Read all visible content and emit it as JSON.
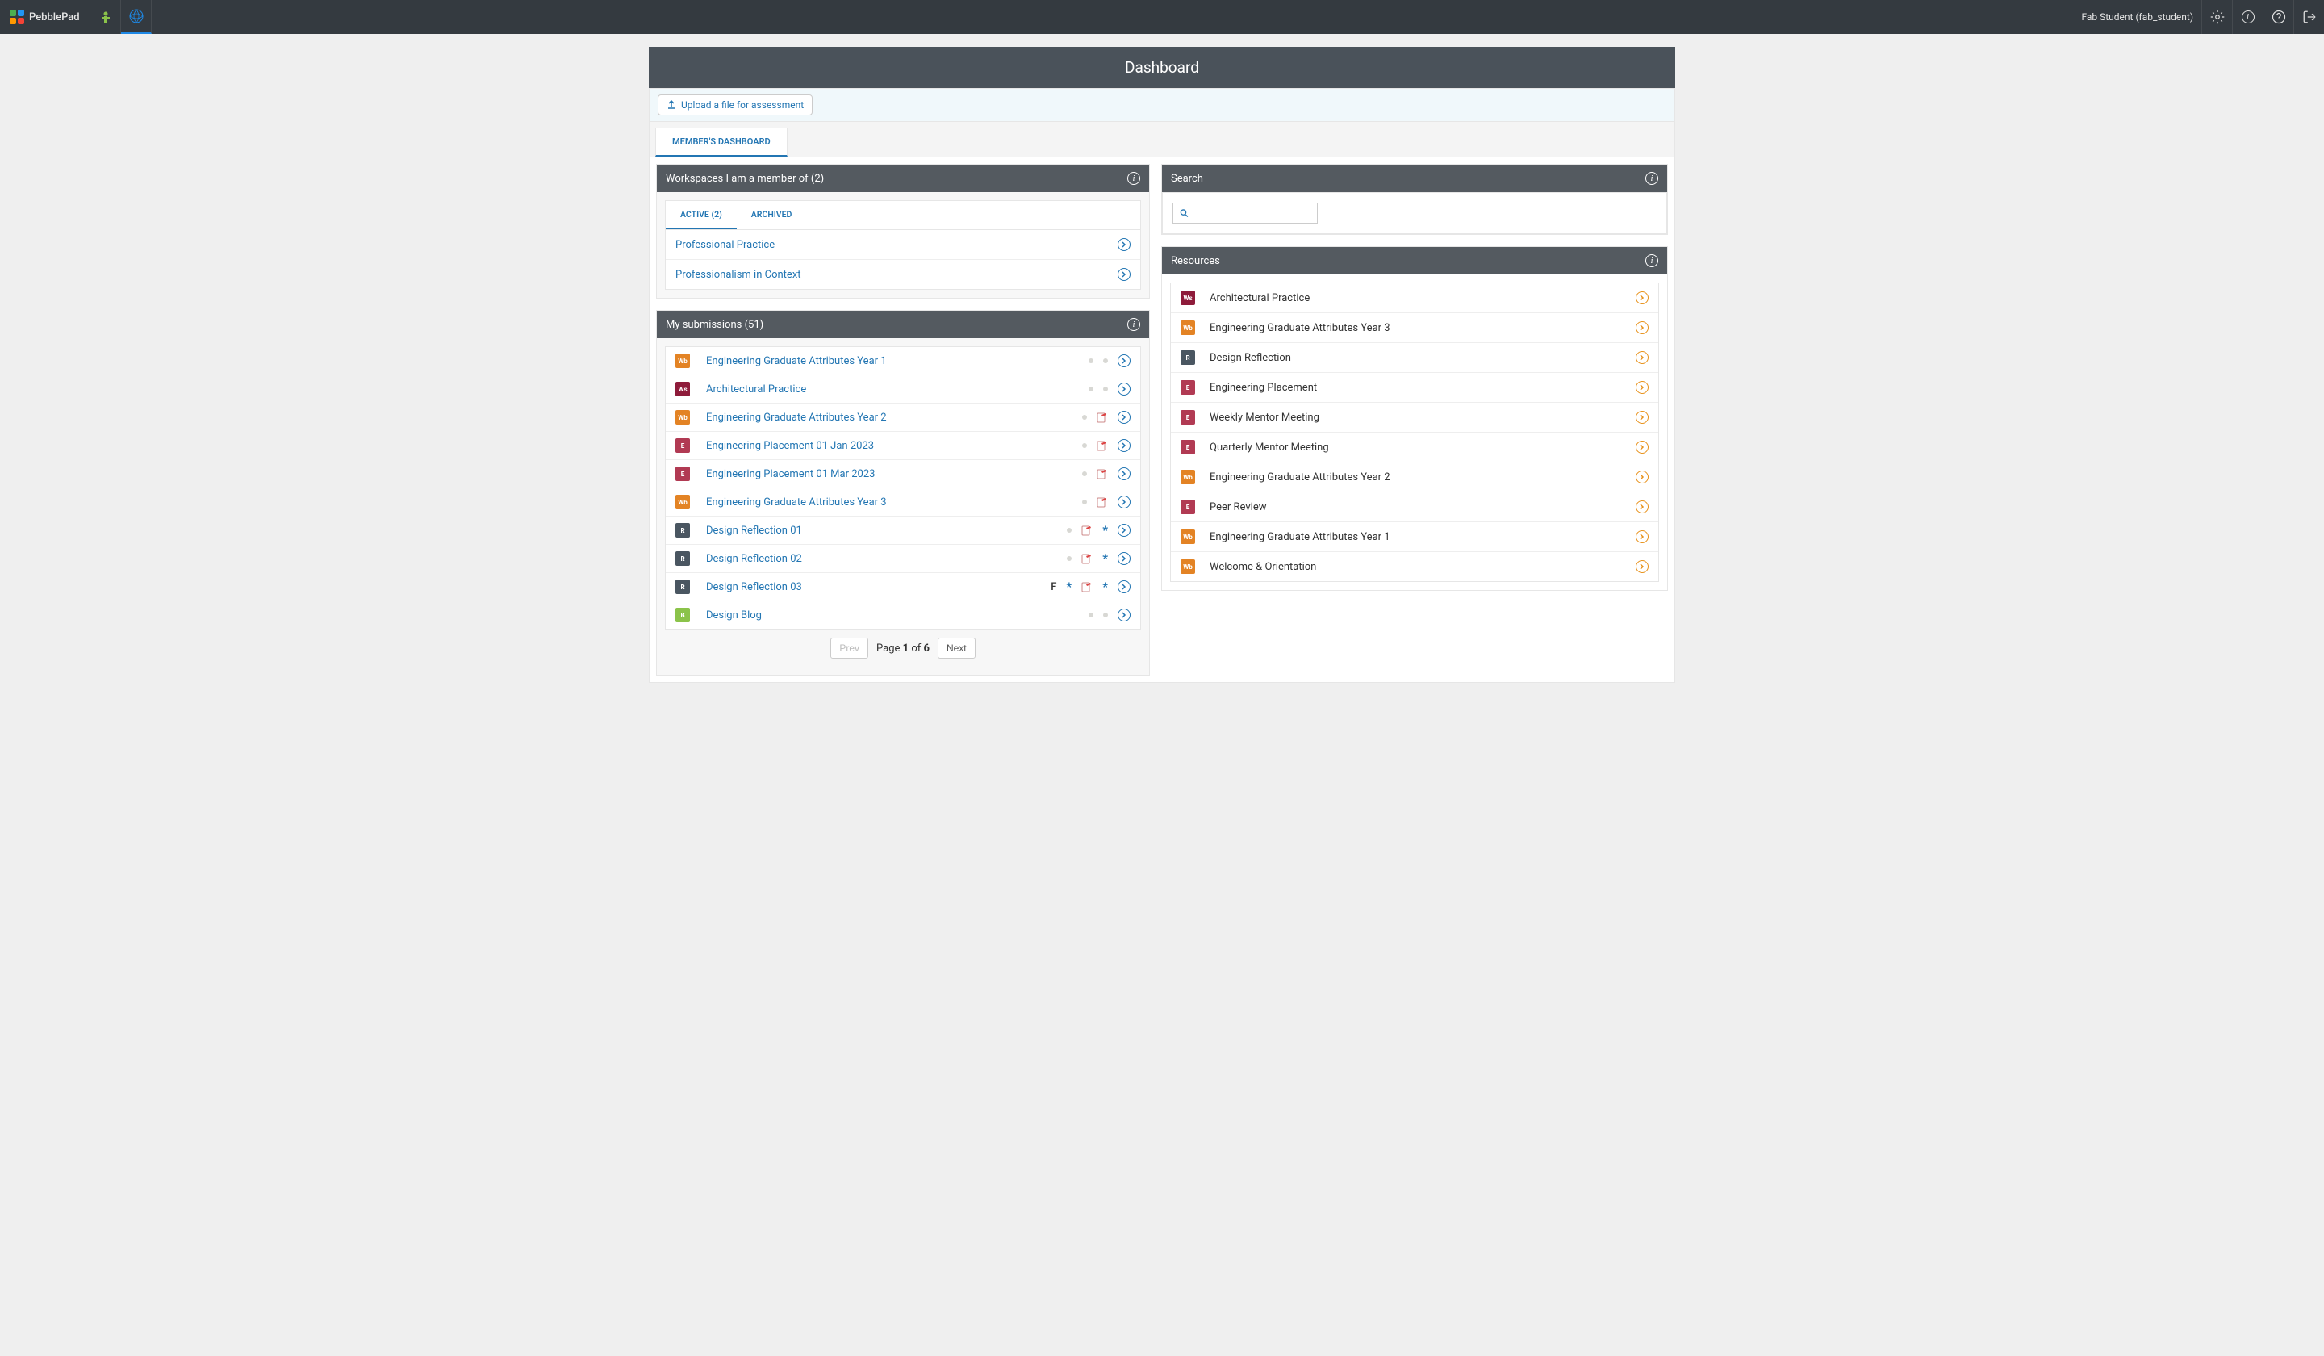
{
  "topbar": {
    "logo_text": "PebblePad",
    "user_label": "Fab Student (fab_student)"
  },
  "banner": {
    "title": "Dashboard"
  },
  "upload": {
    "label": "Upload a file for assessment"
  },
  "main_tabs": {
    "members_dashboard": "MEMBER'S DASHBOARD"
  },
  "workspaces_panel": {
    "header": "Workspaces I am a member of (2)",
    "tabs": {
      "active": "ACTIVE (2)",
      "archived": "ARCHIVED"
    },
    "items": [
      {
        "label": "Professional Practice",
        "underline": true
      },
      {
        "label": "Professionalism in Context",
        "underline": false
      }
    ]
  },
  "submissions_panel": {
    "header": "My submissions (51)",
    "items": [
      {
        "badge": "Wb",
        "color": "#e38324",
        "title": "Engineering Graduate Attributes Year 1",
        "grade": "",
        "feedback": false,
        "asterisk1": false,
        "asterisk2": false,
        "dots": 2
      },
      {
        "badge": "Ws",
        "color": "#8e1b3a",
        "title": "Architectural Practice",
        "grade": "",
        "feedback": false,
        "asterisk1": false,
        "asterisk2": false,
        "dots": 2
      },
      {
        "badge": "Wb",
        "color": "#e38324",
        "title": "Engineering Graduate Attributes Year 2",
        "grade": "",
        "feedback": true,
        "asterisk1": false,
        "asterisk2": false,
        "dots": 1
      },
      {
        "badge": "E",
        "color": "#b13a53",
        "title": "Engineering Placement 01 Jan 2023",
        "grade": "",
        "feedback": true,
        "asterisk1": false,
        "asterisk2": false,
        "dots": 1
      },
      {
        "badge": "E",
        "color": "#b13a53",
        "title": "Engineering Placement 01 Mar 2023",
        "grade": "",
        "feedback": true,
        "asterisk1": false,
        "asterisk2": false,
        "dots": 1
      },
      {
        "badge": "Wb",
        "color": "#e38324",
        "title": "Engineering Graduate Attributes Year 3",
        "grade": "",
        "feedback": true,
        "asterisk1": false,
        "asterisk2": false,
        "dots": 1
      },
      {
        "badge": "R",
        "color": "#4a5661",
        "title": "Design Reflection 01",
        "grade": "",
        "feedback": true,
        "asterisk1": false,
        "asterisk2": true,
        "dots": 1
      },
      {
        "badge": "R",
        "color": "#4a5661",
        "title": "Design Reflection 02",
        "grade": "",
        "feedback": true,
        "asterisk1": false,
        "asterisk2": true,
        "dots": 1
      },
      {
        "badge": "R",
        "color": "#4a5661",
        "title": "Design Reflection 03",
        "grade": "F",
        "feedback": true,
        "asterisk1": true,
        "asterisk2": true,
        "dots": 0
      },
      {
        "badge": "B",
        "color": "#8bc34a",
        "title": "Design Blog",
        "grade": "",
        "feedback": false,
        "asterisk1": false,
        "asterisk2": false,
        "dots": 2
      }
    ],
    "pager": {
      "prev": "Prev",
      "page_prefix": "Page ",
      "current": "1",
      "of": " of ",
      "total": "6",
      "next": "Next"
    }
  },
  "search_panel": {
    "header": "Search",
    "placeholder": ""
  },
  "resources_panel": {
    "header": "Resources",
    "items": [
      {
        "badge": "Ws",
        "color": "#8e1b3a",
        "title": "Architectural Practice"
      },
      {
        "badge": "Wb",
        "color": "#e38324",
        "title": "Engineering Graduate Attributes Year 3"
      },
      {
        "badge": "R",
        "color": "#4a5661",
        "title": "Design Reflection"
      },
      {
        "badge": "E",
        "color": "#b13a53",
        "title": "Engineering Placement"
      },
      {
        "badge": "E",
        "color": "#b13a53",
        "title": "Weekly Mentor Meeting"
      },
      {
        "badge": "E",
        "color": "#b13a53",
        "title": "Quarterly Mentor Meeting"
      },
      {
        "badge": "Wb",
        "color": "#e38324",
        "title": "Engineering Graduate Attributes Year 2"
      },
      {
        "badge": "E",
        "color": "#b13a53",
        "title": "Peer Review"
      },
      {
        "badge": "Wb",
        "color": "#e38324",
        "title": "Engineering Graduate Attributes Year 1"
      },
      {
        "badge": "Wb",
        "color": "#e38324",
        "title": "Welcome & Orientation"
      }
    ]
  }
}
